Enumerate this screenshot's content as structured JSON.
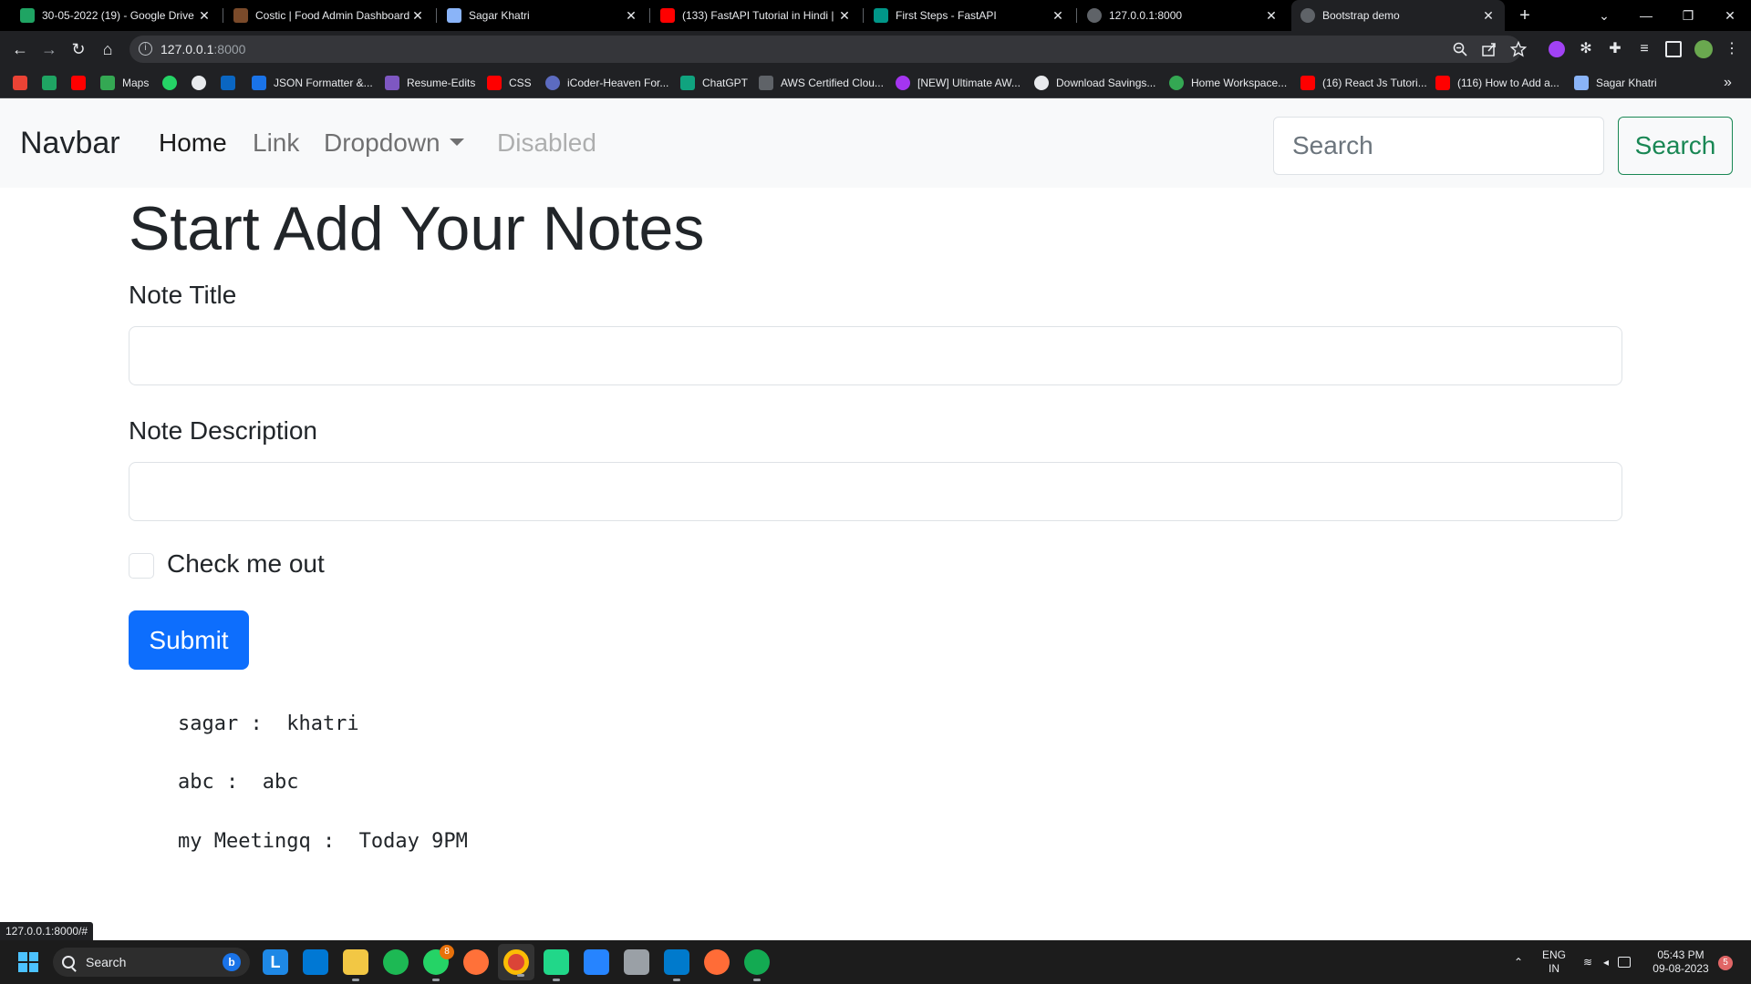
{
  "browser": {
    "tabs": [
      {
        "title": "30-05-2022 (19) - Google Drive",
        "icon": "google-drive-icon",
        "color": "#1fa463"
      },
      {
        "title": "Costic | Food Admin Dashboard",
        "icon": "costic-icon",
        "color": "#7a4a2a"
      },
      {
        "title": "Sagar Khatri",
        "icon": "profile-icon",
        "color": "#8ab4f8"
      },
      {
        "title": "(133) FastAPI Tutorial in Hindi | L",
        "icon": "youtube-icon",
        "color": "#ff0000"
      },
      {
        "title": "First Steps - FastAPI",
        "icon": "fastapi-icon",
        "color": "#009688"
      },
      {
        "title": "127.0.0.1:8000",
        "icon": "globe-icon",
        "color": "#9aa0a6"
      },
      {
        "title": "Bootstrap demo",
        "icon": "globe-icon",
        "color": "#9aa0a6"
      }
    ],
    "new_tab": "+",
    "url_host": "127.0.0.1",
    "url_port": ":8000",
    "bookmarks": [
      {
        "label": "",
        "icon": "gmail-icon",
        "color": "#ea4335"
      },
      {
        "label": "",
        "icon": "google-drive-icon",
        "color": "#1fa463"
      },
      {
        "label": "",
        "icon": "youtube-icon",
        "color": "#ff0000"
      },
      {
        "label": "Maps",
        "icon": "maps-icon",
        "color": "#34a853"
      },
      {
        "label": "",
        "icon": "whatsapp-icon",
        "color": "#25d366"
      },
      {
        "label": "",
        "icon": "github-icon",
        "color": "#e8eaed"
      },
      {
        "label": "",
        "icon": "linkedin-icon",
        "color": "#0a66c2"
      },
      {
        "label": "JSON Formatter &...",
        "icon": "json-formatter-icon",
        "color": "#1a73e8"
      },
      {
        "label": "Resume-Edits",
        "icon": "resume-icon",
        "color": "#7e57c2"
      },
      {
        "label": "CSS",
        "icon": "youtube-icon",
        "color": "#ff0000"
      },
      {
        "label": "iCoder-Heaven For...",
        "icon": "icoder-icon",
        "color": "#5c6bc0"
      },
      {
        "label": "ChatGPT",
        "icon": "chatgpt-icon",
        "color": "#10a37f"
      },
      {
        "label": "AWS Certified Clou...",
        "icon": "aws-icon",
        "color": "#5f6368"
      },
      {
        "label": "[NEW] Ultimate AW...",
        "icon": "udemy-icon",
        "color": "#a435f0"
      },
      {
        "label": "Download Savings...",
        "icon": "download-icon",
        "color": "#e8eaed"
      },
      {
        "label": "Home Workspace...",
        "icon": "workspace-icon",
        "color": "#34a853"
      },
      {
        "label": "(16) React Js Tutori...",
        "icon": "youtube-icon",
        "color": "#ff0000"
      },
      {
        "label": "(116) How to Add a...",
        "icon": "youtube-icon",
        "color": "#ff0000"
      },
      {
        "label": "Sagar Khatri",
        "icon": "profile-icon",
        "color": "#8ab4f8"
      }
    ],
    "status_url": "127.0.0.1:8000/#"
  },
  "navbar": {
    "brand": "Navbar",
    "links": [
      {
        "label": "Home",
        "state": "active"
      },
      {
        "label": "Link",
        "state": "normal"
      },
      {
        "label": "Dropdown",
        "state": "dropdown"
      },
      {
        "label": "Disabled",
        "state": "disabled"
      }
    ],
    "search_placeholder": "Search",
    "search_button": "Search"
  },
  "main": {
    "title": "Start Add Your Notes",
    "note_title_label": "Note Title",
    "note_title_value": "",
    "note_description_label": "Note Description",
    "note_description_value": "",
    "checkbox_label": "Check me out",
    "checkbox_checked": false,
    "submit_label": "Submit"
  },
  "notes": [
    {
      "text": "sagar :  khatri"
    },
    {
      "text": "abc :  abc"
    },
    {
      "text": "my Meetingq :  Today 9PM"
    }
  ],
  "taskbar": {
    "search_label": "Search",
    "whatsapp_badge": "8",
    "language_line1": "ENG",
    "language_line2": "IN",
    "time": "05:43 PM",
    "date": "09-08-2023",
    "notification_count": "5"
  },
  "colors": {
    "primary": "#0d6efd",
    "success": "#198754",
    "navbar_bg": "#f8f9fa"
  }
}
